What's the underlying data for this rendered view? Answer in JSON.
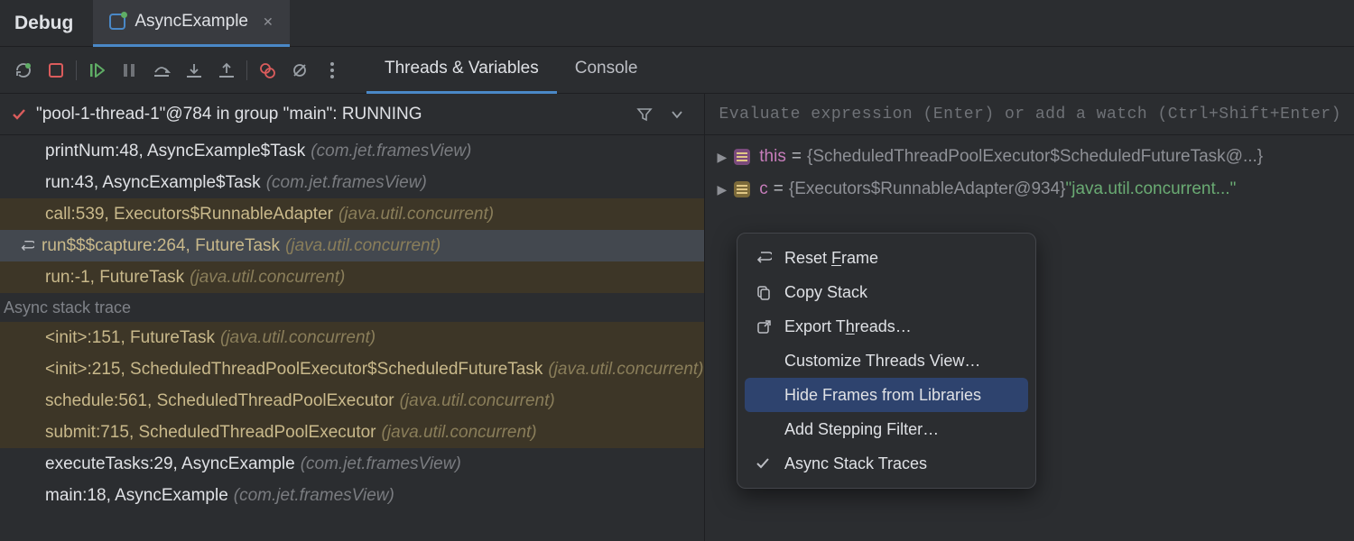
{
  "header": {
    "title": "Debug",
    "tab_label": "AsyncExample"
  },
  "panel_tabs": {
    "threads": "Threads & Variables",
    "console": "Console"
  },
  "thread": {
    "label": "\"pool-1-thread-1\"@784 in group \"main\": RUNNING"
  },
  "frames": [
    {
      "sig": "printNum:48, AsyncExample$Task",
      "pkg": "(com.jet.framesView)",
      "lib": false
    },
    {
      "sig": "run:43, AsyncExample$Task",
      "pkg": "(com.jet.framesView)",
      "lib": false
    },
    {
      "sig": "call:539, Executors$RunnableAdapter",
      "pkg": "(java.util.concurrent)",
      "lib": true
    },
    {
      "sig": "run$$$capture:264, FutureTask",
      "pkg": "(java.util.concurrent)",
      "lib": true,
      "selected": true,
      "reset": true
    },
    {
      "sig": "run:-1, FutureTask",
      "pkg": "(java.util.concurrent)",
      "lib": true
    }
  ],
  "async_label": "Async stack trace",
  "async_frames": [
    {
      "sig": "<init>:151, FutureTask",
      "pkg": "(java.util.concurrent)",
      "lib": true
    },
    {
      "sig": "<init>:215, ScheduledThreadPoolExecutor$ScheduledFutureTask",
      "pkg": "(java.util.concurrent)",
      "lib": true
    },
    {
      "sig": "schedule:561, ScheduledThreadPoolExecutor",
      "pkg": "(java.util.concurrent)",
      "lib": true
    },
    {
      "sig": "submit:715, ScheduledThreadPoolExecutor",
      "pkg": "(java.util.concurrent)",
      "lib": true
    },
    {
      "sig": "executeTasks:29, AsyncExample",
      "pkg": "(com.jet.framesView)",
      "lib": false
    },
    {
      "sig": "main:18, AsyncExample",
      "pkg": "(com.jet.framesView)",
      "lib": false
    }
  ],
  "eval": {
    "placeholder": "Evaluate expression (Enter) or add a watch (Ctrl+Shift+Enter)"
  },
  "vars": [
    {
      "name": "this",
      "value": "{ScheduledThreadPoolExecutor$ScheduledFutureTask@...}",
      "kind": "p"
    },
    {
      "name": "c",
      "value": "{Executors$RunnableAdapter@934}",
      "str": "\"java.util.concurrent...\"",
      "kind": "f"
    }
  ],
  "menu": {
    "reset": "Reset Frame",
    "copy": "Copy Stack",
    "export": "Export Threads…",
    "customize": "Customize Threads View…",
    "hide": "Hide Frames from Libraries",
    "filter": "Add Stepping Filter…",
    "async": "Async Stack Traces"
  }
}
